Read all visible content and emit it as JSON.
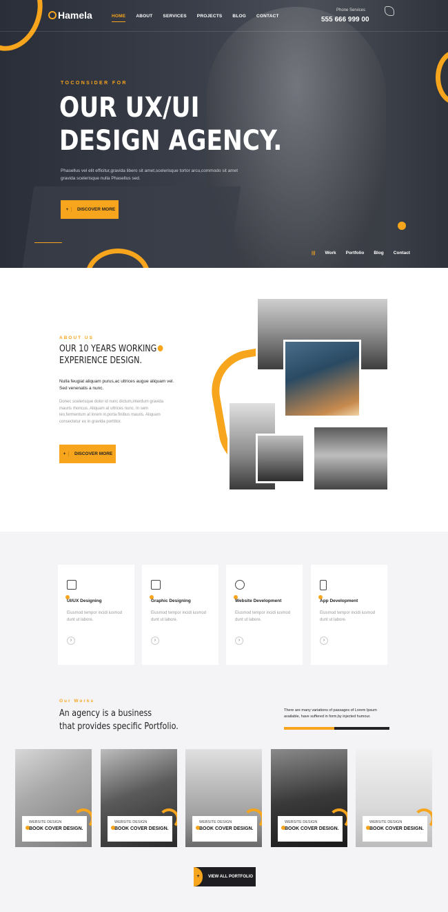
{
  "header": {
    "logo_text": "Hamela",
    "menu": [
      "HOME",
      "ABOUT",
      "SERVICES",
      "PROJECTS",
      "BLOG",
      "CONTACT"
    ],
    "phone_label": "Phone Services",
    "phone_number": "555 666 999 00"
  },
  "hero": {
    "kicker": "TOCONSIDER FOR",
    "title_line1": "OUR UX/UI",
    "title_line2": "DESIGN AGENCY.",
    "desc": "Phasellus vel elit efficitur,gravida libero sit amet,scelerisque tortor arcu,commodo sit amet gravida scelerisque nulla Phasellus sed.",
    "button": "DISCOVER MORE",
    "side_links": [
      "|||",
      "Work",
      "Portfolio",
      "Blog",
      "Contact"
    ]
  },
  "about": {
    "kicker": "ABOUT US",
    "title_line1": "OUR 10 YEARS WORKING",
    "title_line2": "EXPERIENCE DESIGN.",
    "lead": "Nulla feugiat aliquam purus,ac ultrices augue aliquam vel. Sed venenatis a nunc.",
    "body": "Donec scelerisque dolor id nunc dictum,interdum gravida mauris rhoncus. Aliquam at ultrices nunc. In sem leo,fermentum at lorem in,porta finibus mauris. Aliquam consectetur ex in gravida porttitor.",
    "button": "DISCOVER MORE"
  },
  "services": [
    {
      "title": "UI/UX Designing",
      "desc": "Eiusmod tempor incidi iusmod dunt ut labore."
    },
    {
      "title": "Graphic Designing",
      "desc": "Eiusmod tempor incidi iusmod dunt ut labore."
    },
    {
      "title": "Website Development",
      "desc": "Eiusmod tempor incidi iusmod dunt ut labore."
    },
    {
      "title": "App Development",
      "desc": "Eiusmod tempor incidi iusmod dunt ut labore."
    }
  ],
  "works": {
    "kicker": "Our Works",
    "title_line1": "An agency is a business",
    "title_line2": "that provides specific Portfolio.",
    "note": "There are many variations of passages of Lorem Ipsum available, have suffered in form,by injected humour.",
    "progress": 0.48,
    "items": [
      {
        "category": "WEBSITE DESIGN",
        "name": "BOOK COVER DESIGN."
      },
      {
        "category": "WEBSITE DESIGN",
        "name": "BOOK COVER DESIGN."
      },
      {
        "category": "WEBSITE DESIGN",
        "name": "BOOK COVER DESIGN."
      },
      {
        "category": "WEBSITE DESIGN",
        "name": "BOOK COVER DESIGN."
      },
      {
        "category": "WEBSITE DESIGN",
        "name": "BOOK COVER DESIGN."
      }
    ],
    "view_all": "VIEW ALL PORTFOLIO"
  },
  "colors": {
    "accent": "#f7a51c",
    "dark": "#2a2e38"
  }
}
